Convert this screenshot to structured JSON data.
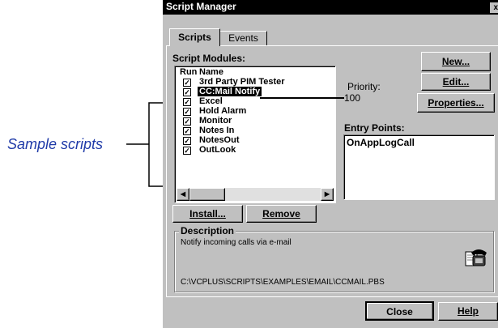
{
  "callout": {
    "label": "Sample scripts"
  },
  "window": {
    "title": "Script Manager",
    "close_glyph": "x"
  },
  "tabs": [
    {
      "label": "Scripts"
    },
    {
      "label": "Events"
    }
  ],
  "script_modules": {
    "label": "Script Modules:",
    "columns": [
      "Run",
      "Name"
    ],
    "rows": [
      {
        "checked": true,
        "name": "3rd Party PIM Tester"
      },
      {
        "checked": true,
        "name": "CC:Mail Notify",
        "selected": true
      },
      {
        "checked": true,
        "name": "Excel"
      },
      {
        "checked": true,
        "name": "Hold Alarm"
      },
      {
        "checked": true,
        "name": "Monitor"
      },
      {
        "checked": true,
        "name": "Notes In"
      },
      {
        "checked": true,
        "name": "NotesOut"
      },
      {
        "checked": true,
        "name": "OutLook"
      }
    ],
    "check_glyph": "✓"
  },
  "buttons": {
    "new": "New...",
    "edit": "Edit...",
    "properties": "Properties...",
    "install": "Install...",
    "remove": "Remove",
    "close": "Close",
    "help": "Help"
  },
  "priority": {
    "label": "Priority:",
    "value": "100"
  },
  "entry_points": {
    "label": "Entry Points:",
    "items": [
      "OnAppLogCall"
    ]
  },
  "description": {
    "label": "Description",
    "text": "Notify incoming calls via e-mail",
    "path": "C:\\VCPLUS\\SCRIPTS\\EXAMPLES\\EMAIL\\CCMAIL.PBS",
    "icon": "phone-mail-icon"
  },
  "scroll": {
    "left_arrow": "◀",
    "right_arrow": "▶"
  }
}
